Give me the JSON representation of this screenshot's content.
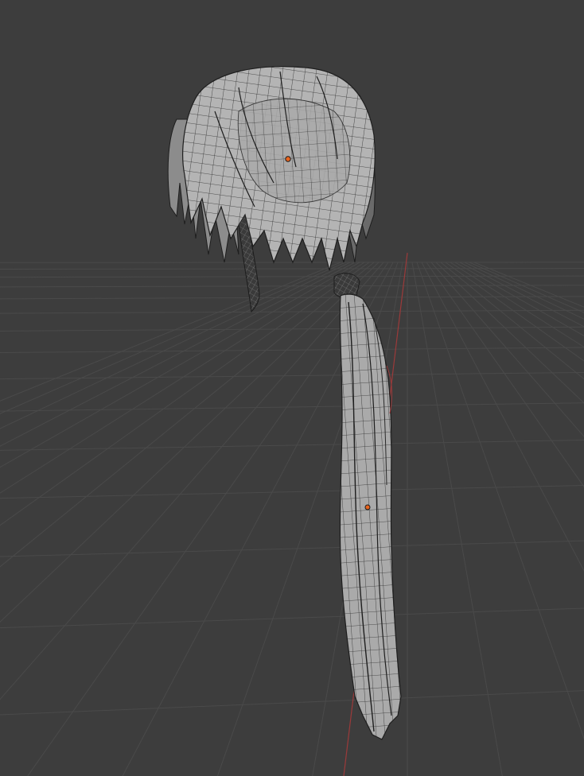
{
  "viewport": {
    "background": "#3d3d3d",
    "grid_color": "#4a4a4a",
    "axis_color": "#9b3a3a",
    "mesh_fill": "#a8a8a8",
    "mesh_fill_light": "#bdbdbd",
    "wire_color": "#2a2a2a",
    "origin_color": "#e8641e",
    "view": "perspective",
    "shading": "solid-wireframe"
  },
  "objects": [
    {
      "kind": "hair-mesh-bangs",
      "selected": false
    },
    {
      "kind": "hair-mesh-ponytail",
      "selected": false
    },
    {
      "kind": "hair-mesh-braid",
      "selected": false
    }
  ]
}
